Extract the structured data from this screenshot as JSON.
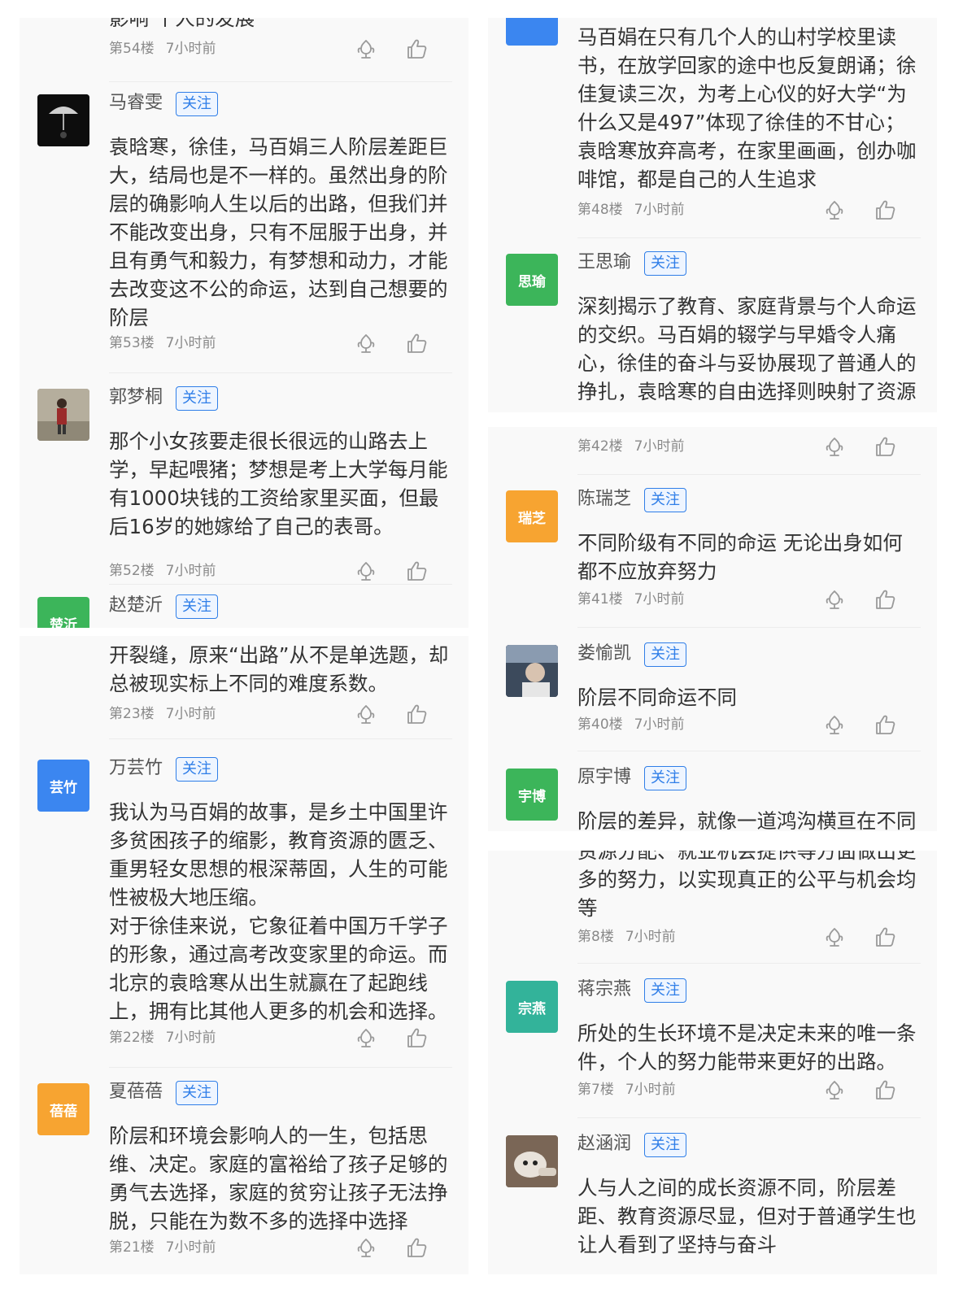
{
  "time": "7小时前",
  "follow_label": "关注",
  "left_top": {
    "partial_top": {
      "text": "影响    个人的发展",
      "floor": "第54楼"
    },
    "c53": {
      "avatar_text": "",
      "name": "马睿雯",
      "floor": "第53楼",
      "text": "袁晗寒，徐佳，马百娟三人阶层差距巨大，结局也是不一样的。虽然出身的阶层的确影响人生以后的出路，但我们并不能改变出身，只有不屈服于出身，并且有勇气和毅力，有梦想和动力，才能去改变这不公的命运，达到自己想要的阶层"
    },
    "c52": {
      "avatar_text": "",
      "name": "郭梦桐",
      "floor": "第52楼",
      "text": "那个小女孩要走很长很远的山路去上学，早起喂猪；梦想是考上大学每月能有1000块钱的工资给家里买面，但最后16岁的她嫁给了自己的表哥。"
    },
    "cpartial": {
      "avatar_text": "楚沂",
      "name": "赵楚沂"
    }
  },
  "left_bottom": {
    "c23": {
      "text": "开裂缝，原来“出路”从不是单选题，却总被现实标上不同的难度系数。",
      "floor": "第23楼"
    },
    "c22": {
      "avatar_text": "芸竹",
      "name": "万芸竹",
      "floor": "第22楼",
      "text": "我认为马百娟的故事，是乡土中国里许多贫困孩子的缩影，教育资源的匮乏、重男轻女思想的根深蒂固，人生的可能性被极大地压缩。\n对于徐佳来说，它象征着中国万千学子的形象，通过高考改变家里的命运。而北京的袁晗寒从出生就赢在了起跑线上，拥有比其他人更多的机会和选择。"
    },
    "c21": {
      "avatar_text": "蓓蓓",
      "name": "夏蓓蓓",
      "floor": "第21楼",
      "text": "阶层和环境会影响人的一生，包括思维、决定。家庭的富裕给了孩子足够的勇气去选择，家庭的贫穷让孩子无法挣脱，只能在为数不多的选择中选择"
    }
  },
  "right_top": {
    "c48": {
      "floor": "第48楼",
      "text": "马百娟在只有几个人的山村学校里读书，在放学回家的途中也反复朗诵；徐佳复读三次，为考上心仪的好大学“为什么又是497”体现了徐佳的不甘心；袁晗寒放弃高考，在家里画画，创办咖啡馆，都是自己的人生追求"
    },
    "cwsy": {
      "avatar_text": "思瑜",
      "name": "王思瑜",
      "text": "深刻揭示了教育、家庭背景与个人命运的交织。马百娟的辍学与早婚令人痛心，徐佳的奋斗与妥协展现了普通人的挣扎，袁晗寒的自由选择则映射了资源"
    }
  },
  "right_mid": {
    "c42": {
      "floor": "第42楼"
    },
    "c41": {
      "avatar_text": "瑞芝",
      "name": "陈瑞芝",
      "floor": "第41楼",
      "text": "不同阶级有不同的命运 无论出身如何都不应放弃努力"
    },
    "c40": {
      "avatar_text": "",
      "name": "娄愉凯",
      "floor": "第40楼",
      "text": "阶层不同命运不同"
    },
    "cyyb": {
      "avatar_text": "宇博",
      "name": "原宇博",
      "text": "阶层的差异，就像一道鸿沟横亘在不同"
    }
  },
  "right_bottom": {
    "c8": {
      "text": "资源分配、就业机会提供等方面做出更多的努力，以实现真正的公平与机会均等",
      "floor": "第8楼"
    },
    "c7": {
      "avatar_text": "宗燕",
      "name": "蒋宗燕",
      "floor": "第7楼",
      "text": "所处的生长环境不是决定未来的唯一条件，个人的努力能带来更好的出路。"
    },
    "c6": {
      "avatar_text": "",
      "name": "赵涵润",
      "text": "人与人之间的成长资源不同，阶层差距、教育资源尽显，但对于普通学生也让人看到了坚持与奋斗"
    }
  },
  "colors": {
    "accent": "#2f7ee8",
    "orange": "#f7a431",
    "green": "#3cb55a",
    "blue": "#3b86f0",
    "teal": "#33b39a"
  }
}
